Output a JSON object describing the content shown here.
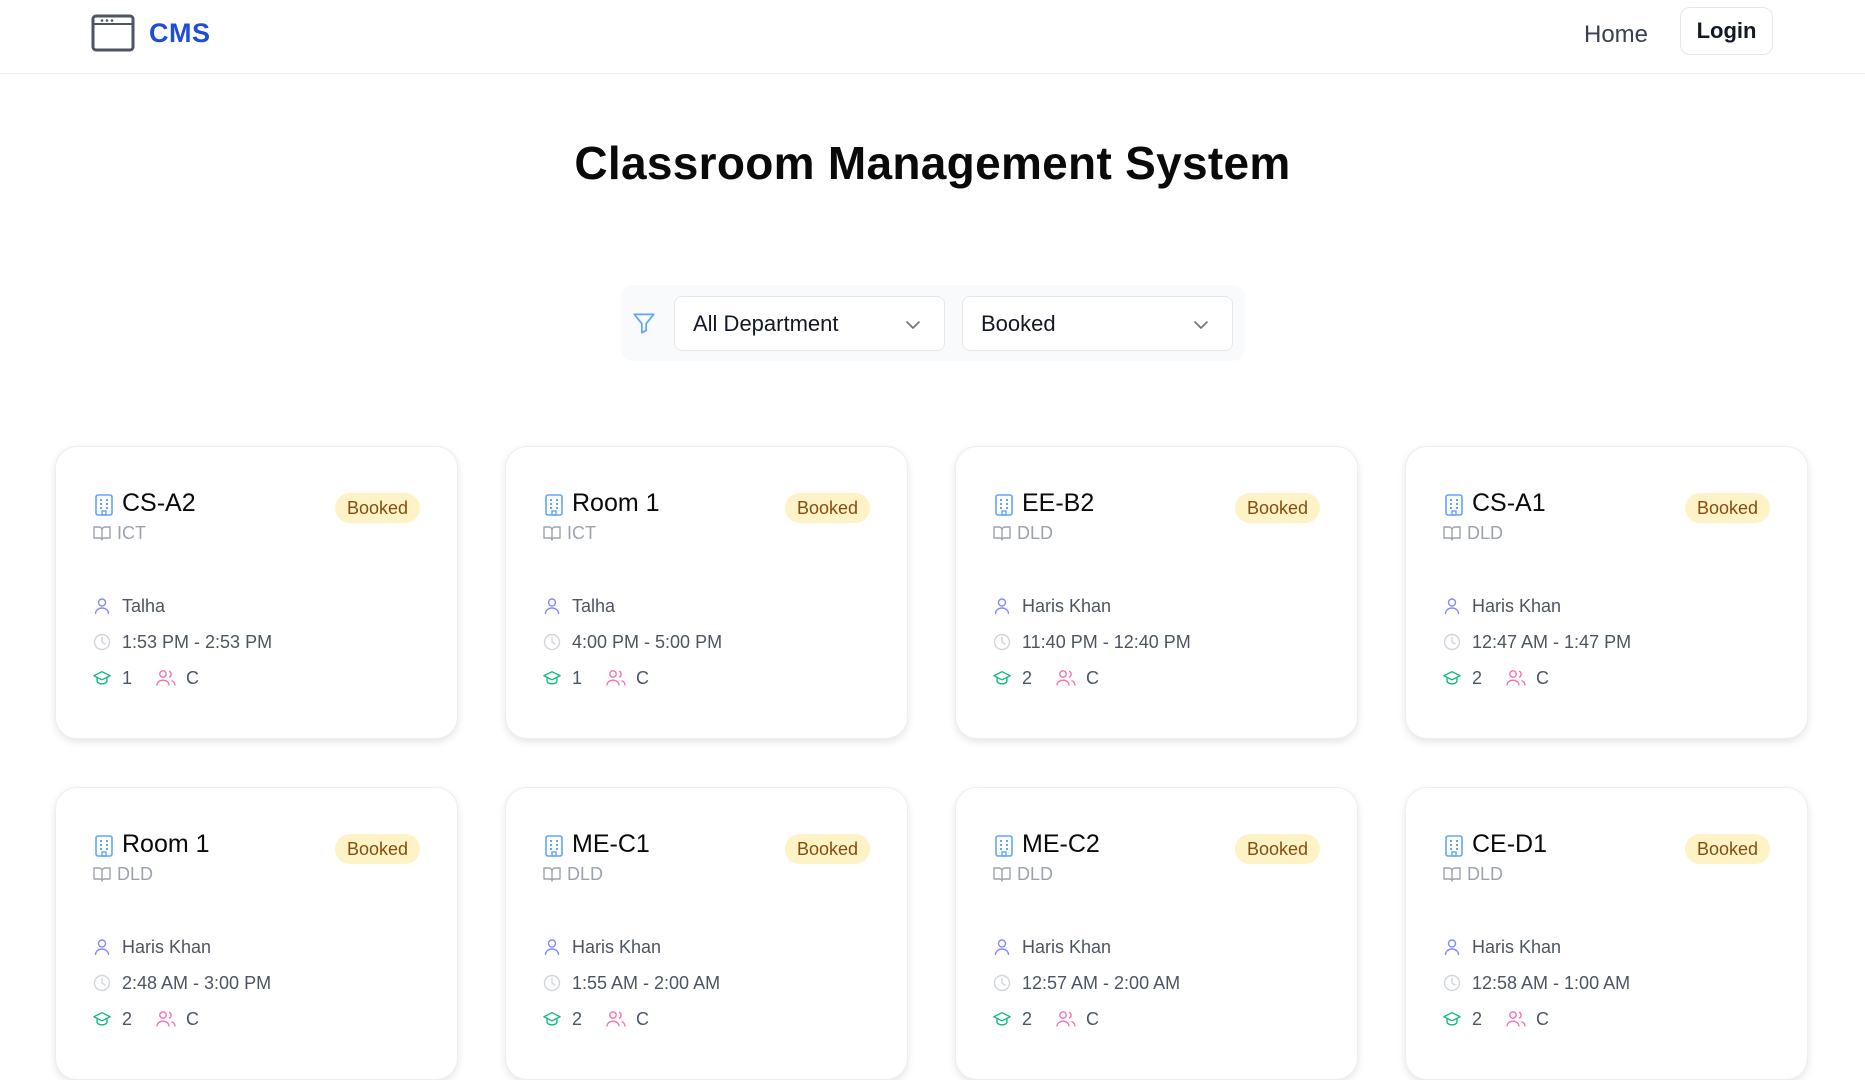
{
  "header": {
    "brand": "CMS",
    "nav_home": "Home",
    "nav_login": "Login"
  },
  "page_title": "Classroom Management System",
  "filters": {
    "department": "All Department",
    "status": "Booked"
  },
  "colors": {
    "brand": "#1d4ed8",
    "badge_bg": "#fef3c7",
    "badge_text": "#854d0e",
    "room_icon": "#60a5fa",
    "teacher_icon": "#818cf8",
    "semester_icon": "#10b981",
    "section_icon": "#f472b6"
  },
  "icons": {
    "brand": "window-icon",
    "filter": "filter-icon",
    "chevron": "chevron-down-icon",
    "room": "building-icon",
    "department": "book-open-icon",
    "teacher": "user-icon",
    "time": "clock-icon",
    "semester": "graduation-cap-icon",
    "section": "users-icon"
  },
  "rooms": [
    {
      "name": "CS-A2",
      "dept": "ICT",
      "status": "Booked",
      "teacher": "Talha",
      "time": "1:53 PM - 2:53 PM",
      "semester": "1",
      "section": "C"
    },
    {
      "name": "Room 1",
      "dept": "ICT",
      "status": "Booked",
      "teacher": "Talha",
      "time": "4:00 PM - 5:00 PM",
      "semester": "1",
      "section": "C"
    },
    {
      "name": "EE-B2",
      "dept": "DLD",
      "status": "Booked",
      "teacher": "Haris Khan",
      "time": "11:40 PM - 12:40 PM",
      "semester": "2",
      "section": "C"
    },
    {
      "name": "CS-A1",
      "dept": "DLD",
      "status": "Booked",
      "teacher": "Haris Khan",
      "time": "12:47 AM - 1:47 PM",
      "semester": "2",
      "section": "C"
    },
    {
      "name": "Room 1",
      "dept": "DLD",
      "status": "Booked",
      "teacher": "Haris Khan",
      "time": "2:48 AM - 3:00 PM",
      "semester": "2",
      "section": "C"
    },
    {
      "name": "ME-C1",
      "dept": "DLD",
      "status": "Booked",
      "teacher": "Haris Khan",
      "time": "1:55 AM - 2:00 AM",
      "semester": "2",
      "section": "C"
    },
    {
      "name": "ME-C2",
      "dept": "DLD",
      "status": "Booked",
      "teacher": "Haris Khan",
      "time": "12:57 AM - 2:00 AM",
      "semester": "2",
      "section": "C"
    },
    {
      "name": "CE-D1",
      "dept": "DLD",
      "status": "Booked",
      "teacher": "Haris Khan",
      "time": "12:58 AM - 1:00 AM",
      "semester": "2",
      "section": "C"
    }
  ]
}
